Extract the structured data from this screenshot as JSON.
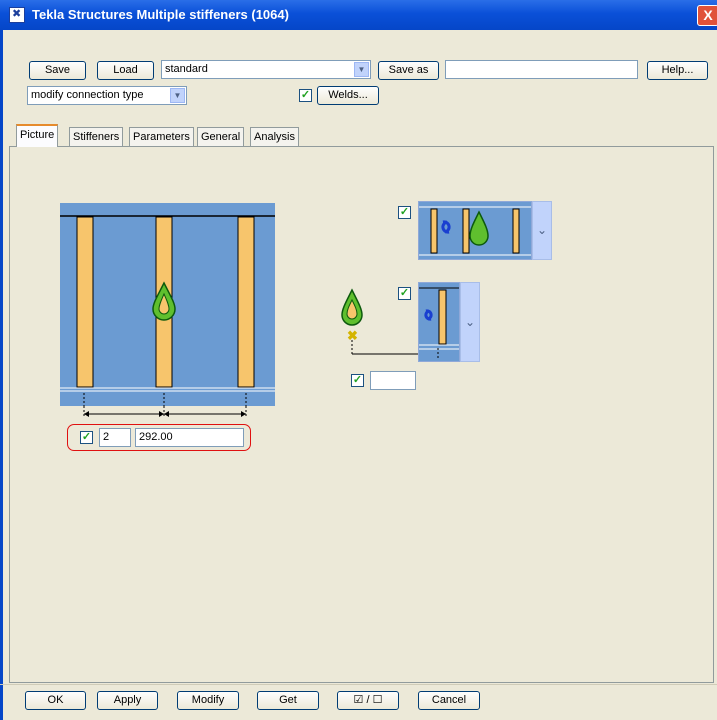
{
  "window": {
    "title": "Tekla Structures  Multiple stiffeners (1064)",
    "close_glyph": "X"
  },
  "toolbar": {
    "save_label": "Save",
    "load_label": "Load",
    "preset_value": "standard",
    "save_as_label": "Save as",
    "save_as_name": "",
    "help_label": "Help...",
    "modify_type_value": "modify connection type",
    "welds_label": "Welds..."
  },
  "tabs": [
    {
      "label": "Picture",
      "active": true
    },
    {
      "label": "Stiffeners",
      "active": false
    },
    {
      "label": "Parameters",
      "active": false
    },
    {
      "label": "General",
      "active": false
    },
    {
      "label": "Analysis",
      "active": false
    }
  ],
  "picture": {
    "stiffener_count": "2",
    "spacing": "292.00",
    "offset_value": ""
  },
  "footer": {
    "ok_label": "OK",
    "apply_label": "Apply",
    "modify_label": "Modify",
    "get_label": "Get",
    "toggle_label": "☑ / ☐",
    "cancel_label": "Cancel"
  },
  "colors": {
    "title_blue": "#0a50d8",
    "plate_blue": "#6b9bd2",
    "stiffener_orange": "#f7c56c",
    "highlight_red": "#e01010",
    "check_green": "#21a121"
  },
  "icons": [
    "app-icon",
    "close-icon",
    "chevron-down-icon",
    "checkbox-icon",
    "symbol-icon",
    "rotate-icon"
  ]
}
